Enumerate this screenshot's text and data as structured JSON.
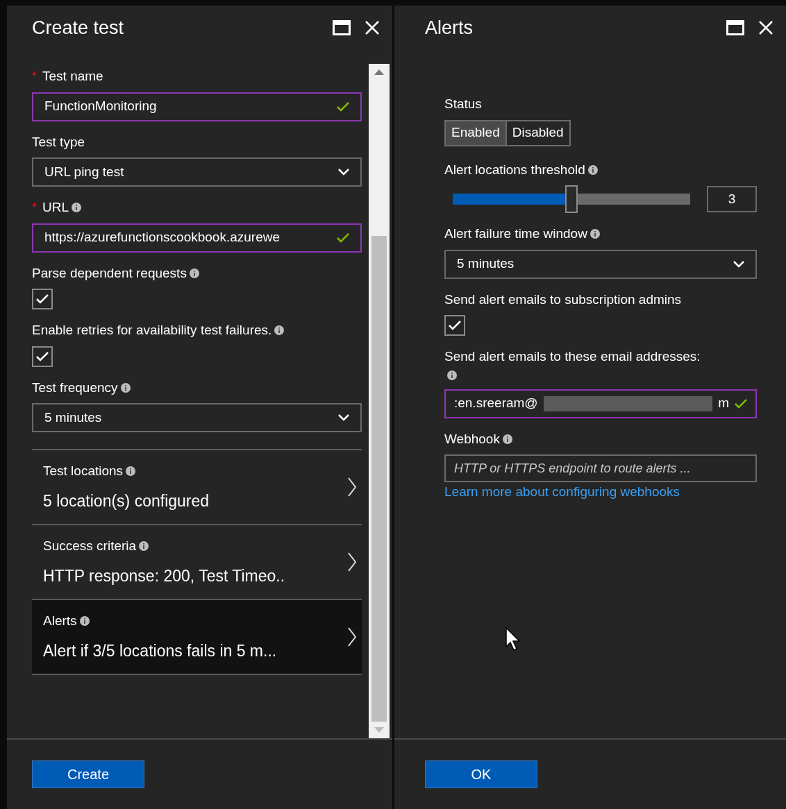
{
  "create_panel": {
    "title": "Create test",
    "fields": [
      {
        "kind": "text",
        "required_mark": "*",
        "label": "Test name",
        "info": false,
        "value": "FunctionMonitoring",
        "valid": true
      },
      {
        "kind": "select",
        "label": "Test type",
        "info": false,
        "value": "URL ping test"
      },
      {
        "kind": "text",
        "required_mark": "*",
        "label": "URL",
        "info": true,
        "value": "https://azurefunctionscookbook.azurewe",
        "valid": true
      },
      {
        "kind": "checkbox",
        "label": "Parse dependent requests",
        "info": true,
        "checked": true
      },
      {
        "kind": "checkbox",
        "label": "Enable retries for availability test failures.",
        "info": true,
        "checked": true
      },
      {
        "kind": "select",
        "label": "Test frequency",
        "info": true,
        "value": "5 minutes"
      }
    ],
    "nav_items": [
      {
        "label": "Test locations",
        "summary": "5 location(s) configured",
        "selected": false
      },
      {
        "label": "Success criteria",
        "summary": "HTTP response: 200, Test Timeo..",
        "selected": false
      },
      {
        "label": "Alerts",
        "summary": "Alert if 3/5 locations fails in 5 m...",
        "selected": true
      }
    ],
    "button": "Create"
  },
  "alerts_panel": {
    "title": "Alerts",
    "fields": [
      {
        "kind": "segmented",
        "label": "Status",
        "info": false,
        "options": [
          {
            "label": "Enabled",
            "selected": true
          },
          {
            "label": "Disabled",
            "selected": false
          }
        ]
      },
      {
        "kind": "slider",
        "label": "Alert locations threshold",
        "info": true,
        "level": 0.5,
        "value": "3"
      },
      {
        "kind": "select",
        "label": "Alert failure time window",
        "info": true,
        "value": "5 minutes"
      },
      {
        "kind": "checkbox",
        "label": "Send alert emails to subscription admins",
        "info": false,
        "checked": true
      },
      {
        "kind": "email",
        "label": "Send alert emails to these email addresses:",
        "info": true,
        "value_start": ":en.sreeram@",
        "value_end": "m",
        "valid": true
      },
      {
        "kind": "webhook",
        "label": "Webhook",
        "info": true,
        "placeholder": "HTTP or HTTPS endpoint to route alerts ...",
        "link": "Learn more about configuring webhooks"
      }
    ],
    "button": "OK"
  }
}
